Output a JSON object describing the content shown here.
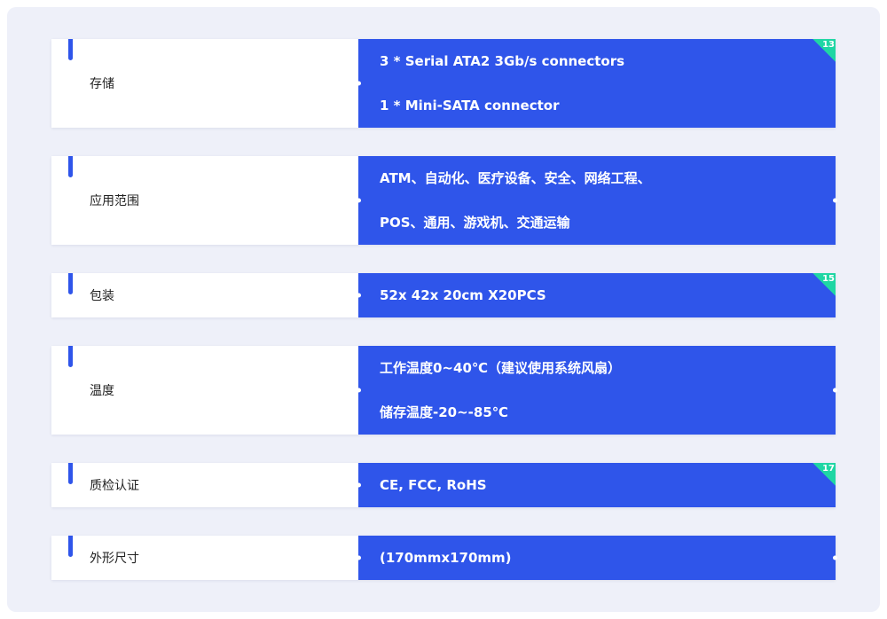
{
  "rows": [
    {
      "label": "存储",
      "lines": [
        "3 * Serial ATA2 3Gb/s connectors",
        "1 * Mini-SATA connector"
      ],
      "badge": "13"
    },
    {
      "label": "应用范围",
      "lines": [
        "ATM、自动化、医疗设备、安全、网络工程、",
        "POS、通用、游戏机、交通运输"
      ],
      "badge": ""
    },
    {
      "label": "包装",
      "lines": [
        "52x 42x 20cm X20PCS"
      ],
      "badge": "15"
    },
    {
      "label": "温度",
      "lines": [
        "工作温度0~40℃（建议使用系统风扇）",
        "储存温度-20~-85℃"
      ],
      "badge": ""
    },
    {
      "label": "质检认证",
      "lines": [
        "CE, FCC, RoHS"
      ],
      "badge": "17"
    },
    {
      "label": "外形尺寸",
      "lines": [
        "(170mmx170mm)"
      ],
      "badge": ""
    }
  ],
  "colors": {
    "accent": "#2f55ea",
    "badge": "#1fd6a4",
    "background": "#eef0f9"
  }
}
